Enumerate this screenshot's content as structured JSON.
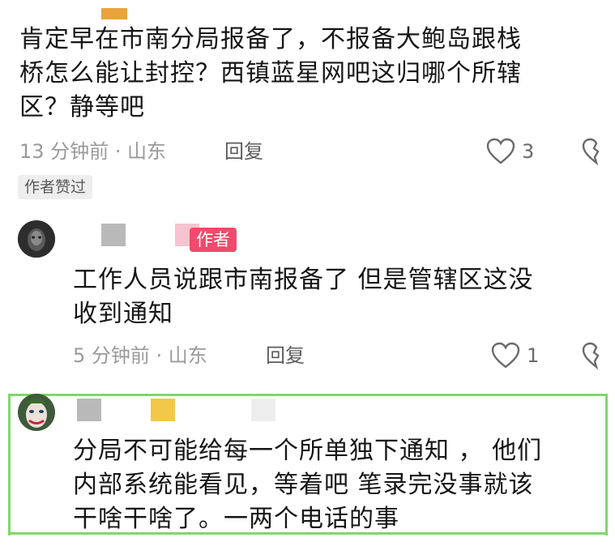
{
  "comments": [
    {
      "text_lines": [
        "肯定早在市南分局报备了，不报备大鲍岛跟栈",
        "桥怎么能让封控？西镇蓝星网吧这归哪个所辖",
        "区？静等吧"
      ],
      "time_location": "13 分钟前 · 山东",
      "reply_label": "回复",
      "like_count": "3",
      "badge": "作者赞过"
    },
    {
      "author_badge": "作者",
      "text_lines": [
        "工作人员说跟市南报备了 但是管辖区这没",
        "收到通知"
      ],
      "time_location": "5 分钟前 · 山东",
      "reply_label": "回复",
      "like_count": "1"
    },
    {
      "text_lines": [
        "分局不可能给每一个所单独下通知 ， 他们",
        "内部系统能看见，等着吧 笔录完没事就该",
        "干啥干啥了。一两个电话的事"
      ]
    }
  ],
  "colors": {
    "highlight_border": "#7ed86a",
    "author_badge": "#f04a6c",
    "meta_text": "#9a9a9a"
  }
}
